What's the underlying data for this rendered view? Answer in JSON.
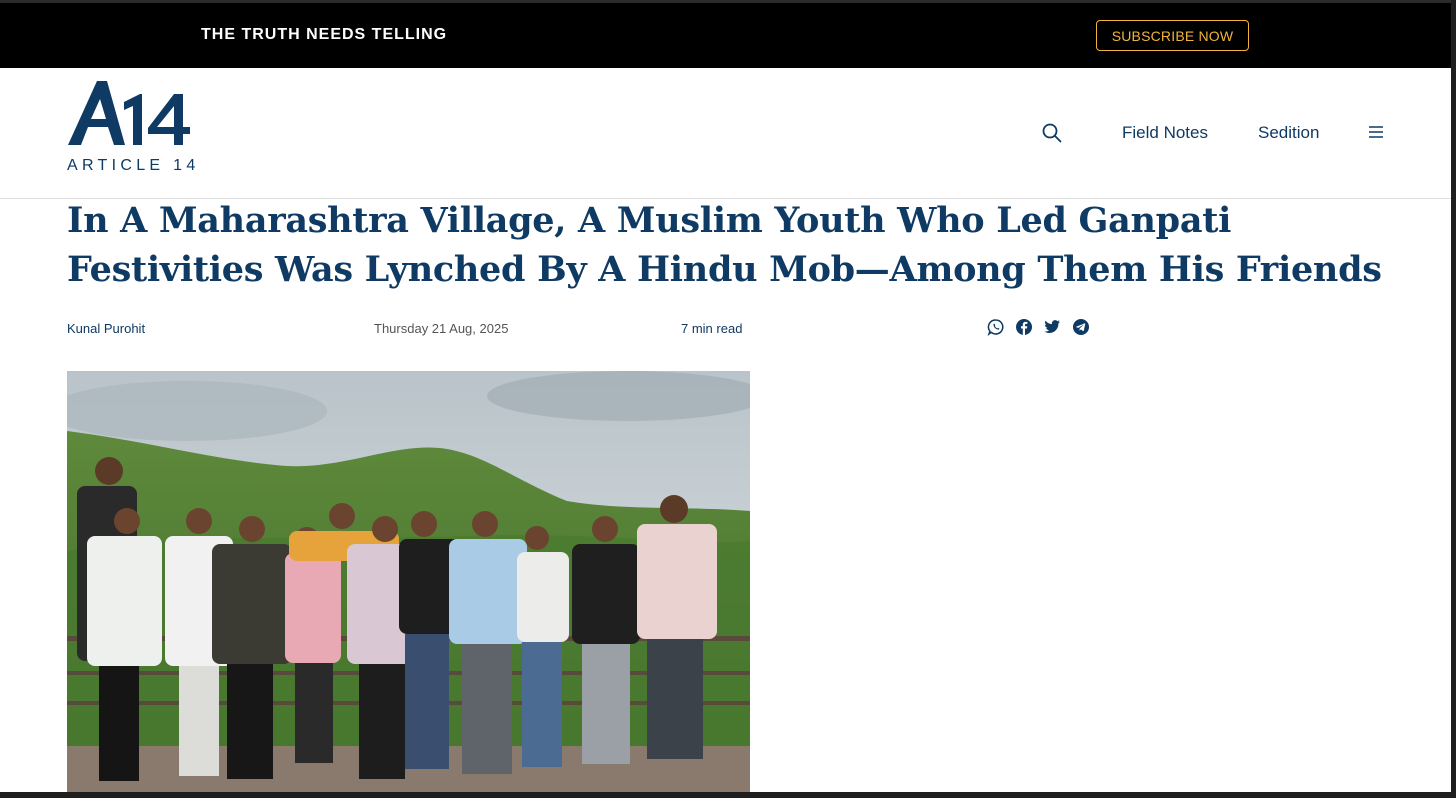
{
  "promo": {
    "tagline": "THE TRUTH NEEDS TELLING",
    "subscribe_label": "SUBSCRIBE NOW"
  },
  "header": {
    "logo_mark": "A14",
    "logo_text": "ARTICLE 14",
    "nav": {
      "search_icon": "search-icon",
      "links": [
        "Field Notes",
        "Sedition"
      ],
      "menu_icon": "hamburger-menu-icon"
    }
  },
  "article": {
    "title": "In A Maharashtra Village, A Muslim Youth Who Led Ganpati Festivities Was Lynched By A Hindu Mob—Among Them His Friends",
    "author": "Kunal Purohit",
    "date": "Thursday 21 Aug, 2025",
    "read_time": "7 min read",
    "share_icons": [
      "whatsapp-icon",
      "facebook-icon",
      "twitter-icon",
      "telegram-icon"
    ],
    "hero_image": "group-photo-of-young-men-on-hilltop"
  },
  "colors": {
    "brand_navy": "#0e3a63",
    "accent_gold": "#f0b43c",
    "topbar_bg": "#000000"
  }
}
